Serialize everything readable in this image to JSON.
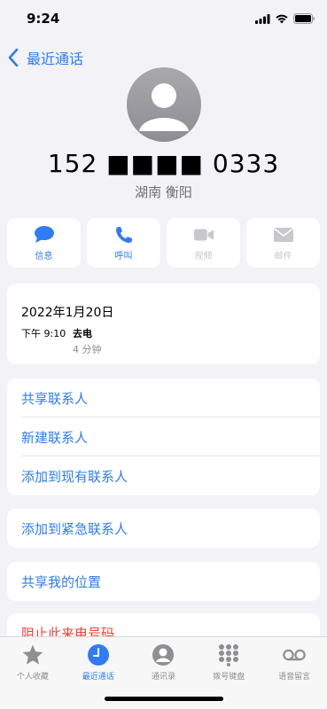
{
  "status_bar": {
    "time": "9:24"
  },
  "nav": {
    "back_label": "最近通话"
  },
  "contact": {
    "phone_number": "152 ■■■■ 0333",
    "location": "湖南 衡阳"
  },
  "actions": [
    {
      "label": "信息",
      "icon": "message-icon",
      "enabled": true
    },
    {
      "label": "呼叫",
      "icon": "phone-icon",
      "enabled": true
    },
    {
      "label": "视频",
      "icon": "video-icon",
      "enabled": false
    },
    {
      "label": "邮件",
      "icon": "mail-icon",
      "enabled": false
    }
  ],
  "call_log": {
    "date": "2022年1月20日",
    "time": "下午 9:10",
    "type": "去电",
    "duration": "4 分钟"
  },
  "contact_options": [
    {
      "label": "共享联系人"
    },
    {
      "label": "新建联系人"
    },
    {
      "label": "添加到现有联系人"
    }
  ],
  "emergency_option": {
    "label": "添加到紧急联系人"
  },
  "share_location_option": {
    "label": "共享我的位置"
  },
  "block_option": {
    "label": "阻止此来电号码"
  },
  "tabs": [
    {
      "label": "个人收藏",
      "icon": "star-icon",
      "active": false
    },
    {
      "label": "最近通话",
      "icon": "clock-icon",
      "active": true
    },
    {
      "label": "通讯录",
      "icon": "person-circle-icon",
      "active": false
    },
    {
      "label": "拨号键盘",
      "icon": "keypad-icon",
      "active": false
    },
    {
      "label": "语音留言",
      "icon": "voicemail-icon",
      "active": false
    }
  ],
  "colors": {
    "accent": "#2f7cf6",
    "danger": "#ff3b30",
    "background": "#f2f2f7",
    "secondary_text": "#8e8e93"
  }
}
